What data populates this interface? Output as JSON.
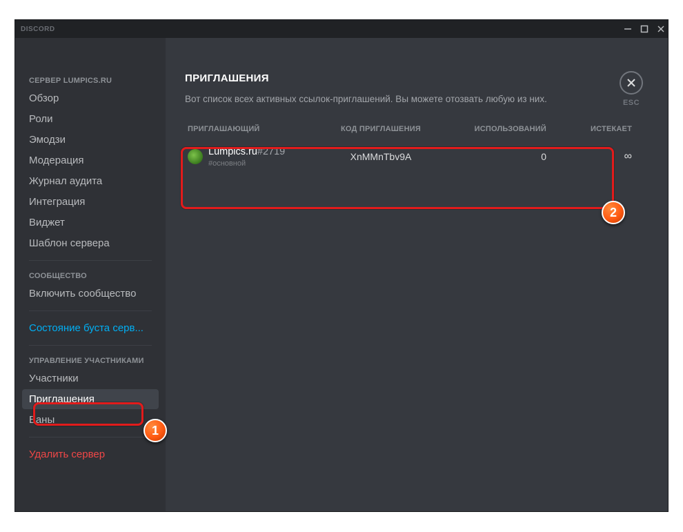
{
  "app": {
    "name": "DISCORD"
  },
  "esc": {
    "label": "ESC"
  },
  "sidebar": {
    "header_server": "СЕРВЕР LUMPICS.RU",
    "server_items": [
      "Обзор",
      "Роли",
      "Эмодзи",
      "Модерация",
      "Журнал аудита",
      "Интеграция",
      "Виджет",
      "Шаблон сервера"
    ],
    "header_community": "СООБЩЕСТВО",
    "community_items": [
      "Включить сообщество"
    ],
    "boost_status": "Состояние буста серв...",
    "header_members": "УПРАВЛЕНИЕ УЧАСТНИКАМИ",
    "members_items": [
      "Участники",
      "Приглашения",
      "Баны"
    ],
    "delete_server": "Удалить сервер"
  },
  "page": {
    "title": "ПРИГЛАШЕНИЯ",
    "description": "Вот список всех активных ссылок-приглашений. Вы можете отозвать любую из них."
  },
  "table": {
    "headers": {
      "inviter": "ПРИГЛАШАЮЩИЙ",
      "code": "КОД ПРИГЛАШЕНИЯ",
      "uses": "ИСПОЛЬЗОВАНИЙ",
      "expires": "ИСТЕКАЕТ"
    },
    "row": {
      "inviter_name": "Lumpics.ru",
      "inviter_tag": "#2719",
      "inviter_channel": "#основной",
      "code": "XnMMnTbv9A",
      "uses": "0",
      "expires": "∞"
    }
  },
  "markers": {
    "m1": "1",
    "m2": "2"
  }
}
